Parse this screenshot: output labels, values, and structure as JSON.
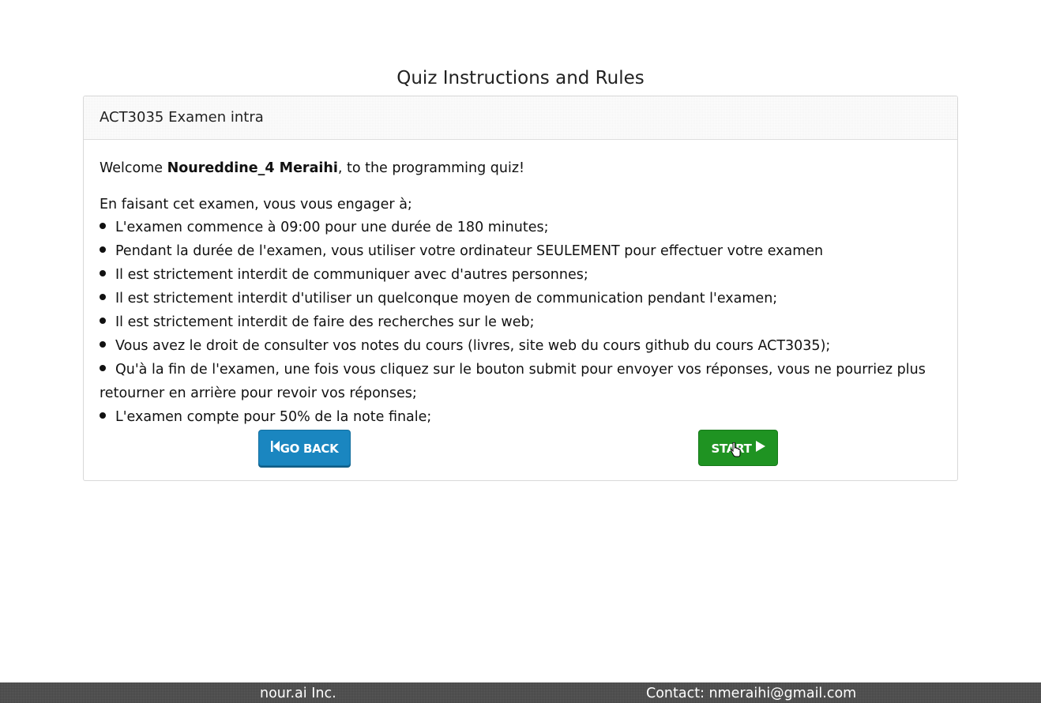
{
  "page": {
    "title": "Quiz Instructions and Rules"
  },
  "panel": {
    "heading": "ACT3035 Examen intra",
    "welcome_prefix": "Welcome ",
    "user_name": "Noureddine_4 Meraihi",
    "welcome_suffix": ", to the programming quiz!",
    "intro": "En faisant cet examen, vous vous engager à;",
    "rules": [
      "L'examen commence à 09:00 pour une durée de 180 minutes;",
      "Pendant la durée de l'examen, vous utiliser votre ordinateur SEULEMENT pour effectuer votre examen",
      "Il est strictement interdit de communiquer avec d'autres personnes;",
      "Il est strictement interdit d'utiliser un quelconque moyen de communication pendant l'examen;",
      "Il est strictement interdit de faire des recherches sur le web;",
      "Vous avez le droit de consulter vos notes du cours (livres, site web du cours github du cours ACT3035);",
      "Qu'à la fin de l'examen, une fois vous cliquez sur le bouton submit pour envoyer vos réponses, vous ne pourriez plus retourner en arrière pour revoir vos réponses;",
      "L'examen compte pour 50% de la note finale;"
    ]
  },
  "buttons": {
    "go_back_label": "GO BACK",
    "go_back_icon": "skip-back-icon",
    "start_label": "START",
    "start_icon": "play-icon",
    "go_back_color": "#1a86c0",
    "start_color": "#1f9322"
  },
  "footer": {
    "company": "nour.ai Inc.",
    "contact": "Contact: nmeraihi@gmail.com",
    "background": "#5a5a5a"
  }
}
